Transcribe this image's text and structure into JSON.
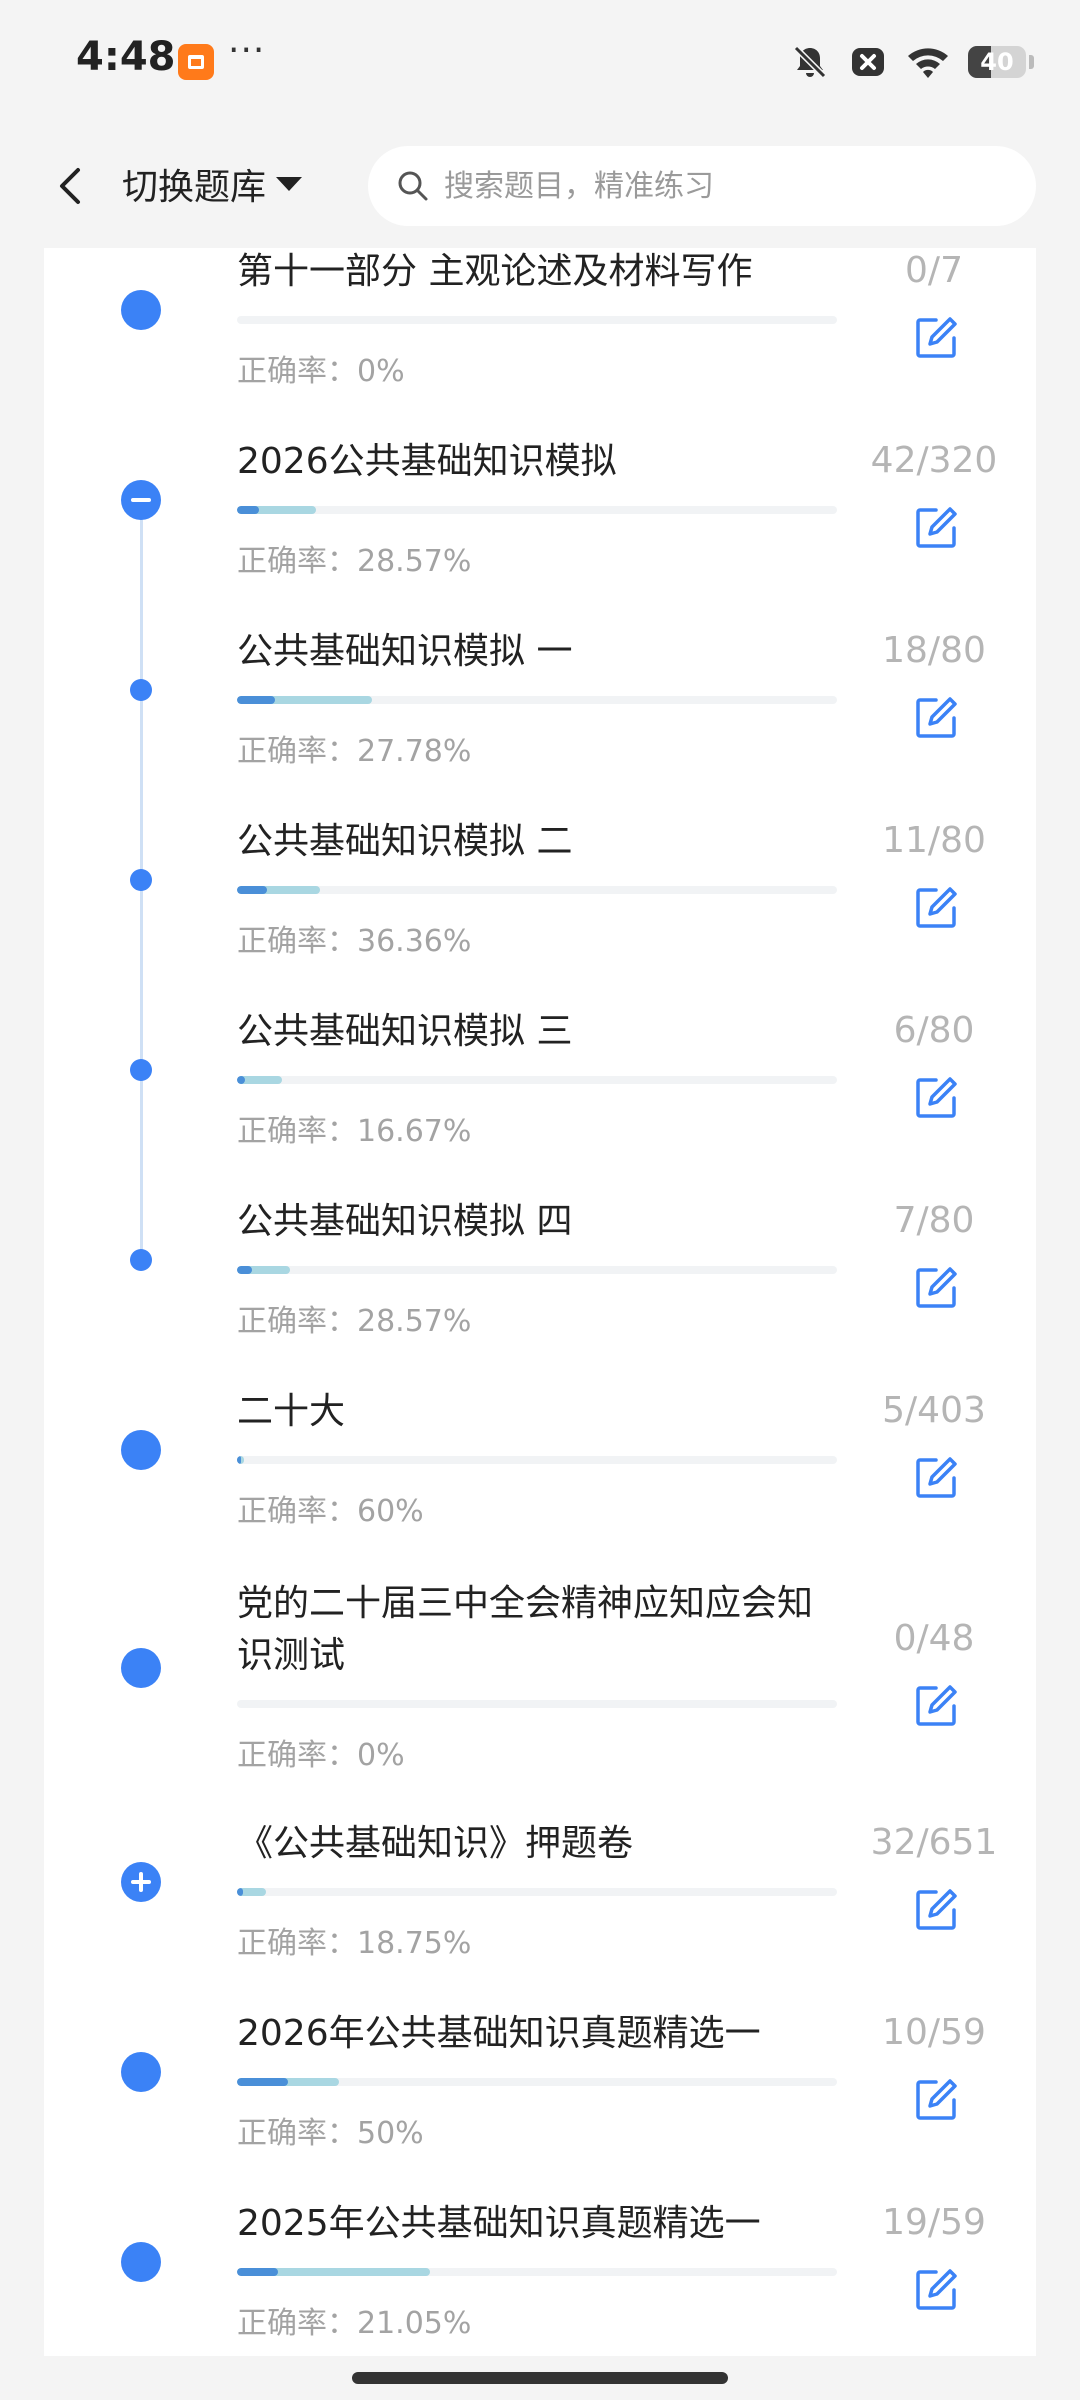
{
  "status_bar": {
    "time": "4:48",
    "more": "···",
    "battery": 40,
    "icons": [
      "shopping-app-icon",
      "bell-muted-icon",
      "close-box-icon",
      "wifi-icon",
      "battery-icon"
    ]
  },
  "header": {
    "back_icon": "chevron-left-icon",
    "switch_label": "切换题库",
    "search_placeholder": "搜索题目，精准练习"
  },
  "colors": {
    "accent": "#3b82f6",
    "bar_track": "#f1f3f5",
    "bar_answered": "#a9d7e2",
    "bar_correct": "#4a8fd8",
    "muted_text": "#a3a3a3"
  },
  "items": [
    {
      "title": "第十一部分 主观论述及材料写作",
      "rate_label": "正确率：",
      "rate": "0%",
      "count": "0/7",
      "answered": 0,
      "total": 7,
      "correct_ratio": 0,
      "node": "big"
    },
    {
      "title": "2026公共基础知识模拟",
      "rate_label": "正确率：",
      "rate": "28.57%",
      "count": "42/320",
      "answered": 42,
      "total": 320,
      "correct_ratio": 0.2857,
      "node": "minus"
    },
    {
      "title": "公共基础知识模拟 一",
      "rate_label": "正确率：",
      "rate": "27.78%",
      "count": "18/80",
      "answered": 18,
      "total": 80,
      "correct_ratio": 0.2778,
      "node": "small"
    },
    {
      "title": "公共基础知识模拟 二",
      "rate_label": "正确率：",
      "rate": "36.36%",
      "count": "11/80",
      "answered": 11,
      "total": 80,
      "correct_ratio": 0.3636,
      "node": "small"
    },
    {
      "title": "公共基础知识模拟 三",
      "rate_label": "正确率：",
      "rate": "16.67%",
      "count": "6/80",
      "answered": 6,
      "total": 80,
      "correct_ratio": 0.1667,
      "node": "small"
    },
    {
      "title": "公共基础知识模拟 四",
      "rate_label": "正确率：",
      "rate": "28.57%",
      "count": "7/80",
      "answered": 7,
      "total": 80,
      "correct_ratio": 0.2857,
      "node": "small"
    },
    {
      "title": "二十大",
      "rate_label": "正确率：",
      "rate": "60%",
      "count": "5/403",
      "answered": 5,
      "total": 403,
      "correct_ratio": 0.6,
      "node": "big"
    },
    {
      "title": "党的二十届三中全会精神应知应会知识测试",
      "rate_label": "正确率：",
      "rate": "0%",
      "count": "0/48",
      "answered": 0,
      "total": 48,
      "correct_ratio": 0,
      "node": "big"
    },
    {
      "title": "《公共基础知识》押题卷",
      "rate_label": "正确率：",
      "rate": "18.75%",
      "count": "32/651",
      "answered": 32,
      "total": 651,
      "correct_ratio": 0.1875,
      "node": "plus"
    },
    {
      "title": "2026年公共基础知识真题精选一",
      "rate_label": "正确率：",
      "rate": "50%",
      "count": "10/59",
      "answered": 10,
      "total": 59,
      "correct_ratio": 0.5,
      "node": "big"
    },
    {
      "title": "2025年公共基础知识真题精选一",
      "rate_label": "正确率：",
      "rate": "21.05%",
      "count": "19/59",
      "answered": 19,
      "total": 59,
      "correct_ratio": 0.2105,
      "node": "big"
    }
  ]
}
